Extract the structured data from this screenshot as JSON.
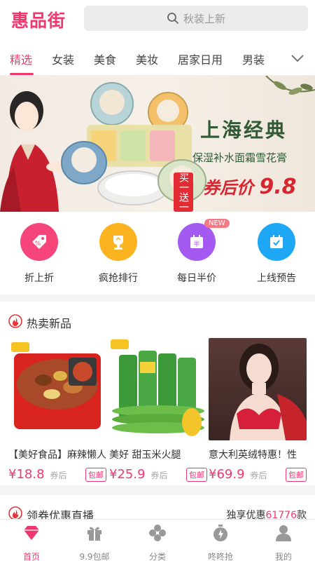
{
  "header": {
    "logo": "惠品街",
    "search_placeholder": "秋装上新"
  },
  "tabs": [
    {
      "label": "精选",
      "active": true
    },
    {
      "label": "女装"
    },
    {
      "label": "美食"
    },
    {
      "label": "美妆"
    },
    {
      "label": "居家日用"
    },
    {
      "label": "男装"
    }
  ],
  "banner": {
    "stamp": "买一送一",
    "title": "上海经典",
    "subtitle": "保湿补水面霜雪花膏",
    "price_prefix": "券后价",
    "price": "9.8"
  },
  "quick_links": [
    {
      "label": "折上折",
      "color": "#f5457a",
      "icon": "percent-tag-icon"
    },
    {
      "label": "疯抢排行",
      "color": "#fbb31f",
      "icon": "trophy-icon"
    },
    {
      "label": "每日半价",
      "color": "#a45af0",
      "icon": "half-price-calendar-icon",
      "badge": "NEW"
    },
    {
      "label": "上线预告",
      "color": "#1ea7f5",
      "icon": "calendar-check-icon"
    }
  ],
  "hot_section": {
    "title": "热卖新品",
    "products": [
      {
        "name": "【美好食品】麻辣懒人",
        "price": "¥18.8",
        "after": "券后",
        "ship": "包邮"
      },
      {
        "name": "美好  甜玉米火腿",
        "price": "¥25.9",
        "after": "券后",
        "ship": "包邮"
      },
      {
        "name": "意大利英绒特惠！性",
        "price": "¥69.9",
        "after": "券后",
        "ship": "包邮"
      }
    ]
  },
  "coupon_section": {
    "title": "领券优惠直播",
    "right_prefix": "独享优惠",
    "right_count": "61776",
    "right_suffix": "款"
  },
  "bottom_nav": [
    {
      "label": "首页",
      "active": true,
      "icon": "home-diamond-icon"
    },
    {
      "label": "9.9包邮",
      "icon": "gift-icon"
    },
    {
      "label": "分类",
      "icon": "category-icon"
    },
    {
      "label": "咚咚抢",
      "icon": "stopwatch-icon"
    },
    {
      "label": "我的",
      "icon": "user-icon"
    }
  ],
  "colors": {
    "accent": "#f0386f"
  }
}
